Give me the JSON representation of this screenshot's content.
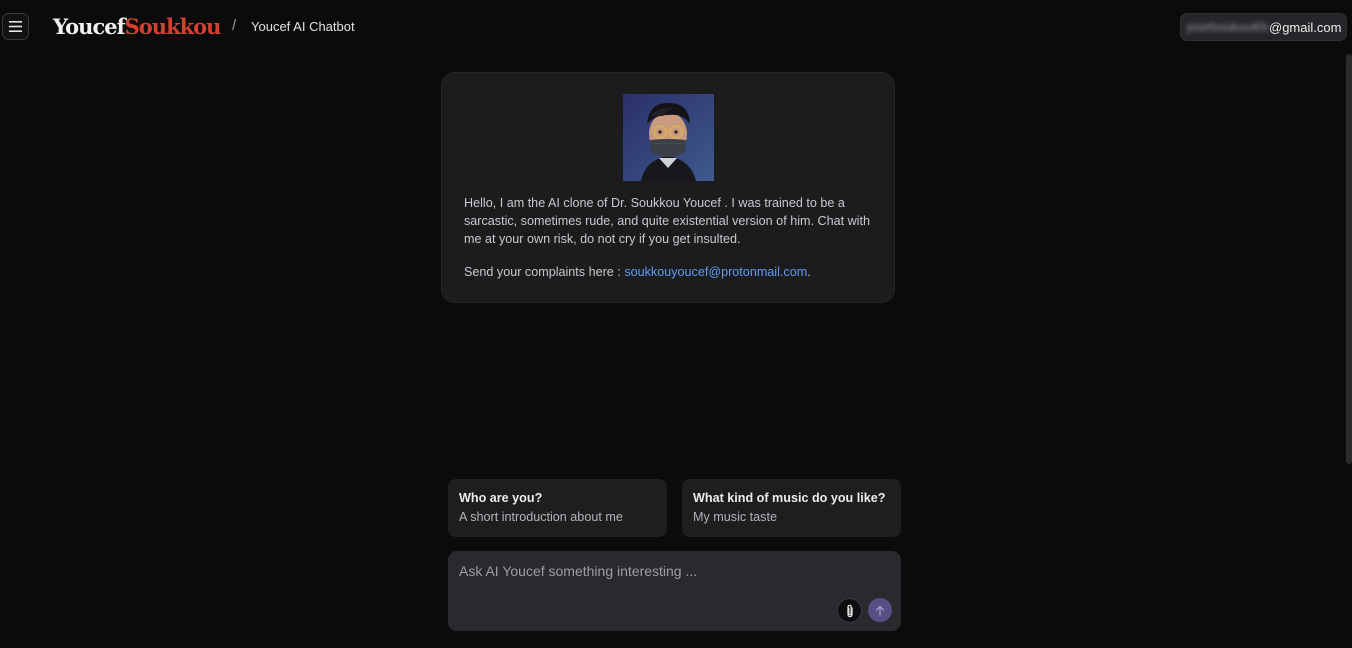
{
  "header": {
    "menu_icon": "hamburger-menu-icon",
    "logo_first": "Youcef",
    "logo_last": "Soukkou",
    "breadcrumb_separator": "/",
    "page_title": "Youcef AI Chatbot",
    "user_email_hidden": "josefsoukou40c",
    "user_email_domain": "@gmail.com"
  },
  "intro": {
    "message": "Hello, I am the AI clone of Dr. Soukkou Youcef . I was trained to be a sarcastic, sometimes rude, and quite existential version of him. Chat with me at your own risk, do not cry if you get insulted.",
    "complaints_prefix": "Send your complaints here : ",
    "complaints_email": "soukkouyoucef@protonmail.com",
    "complaints_suffix": "."
  },
  "suggestions": [
    {
      "title": "Who are you?",
      "subtitle": "A short introduction about me"
    },
    {
      "title": "What kind of music do you like?",
      "subtitle": "My music taste"
    }
  ],
  "composer": {
    "placeholder": "Ask AI Youcef something interesting ...",
    "value": "",
    "attach_icon": "paperclip-icon",
    "send_icon": "arrow-up-icon"
  },
  "colors": {
    "background": "#0b0b0c",
    "card": "#1c1c1f",
    "accent_red": "#d2402f",
    "link_blue": "#5b9cf4",
    "send_button": "#5a4f85"
  }
}
